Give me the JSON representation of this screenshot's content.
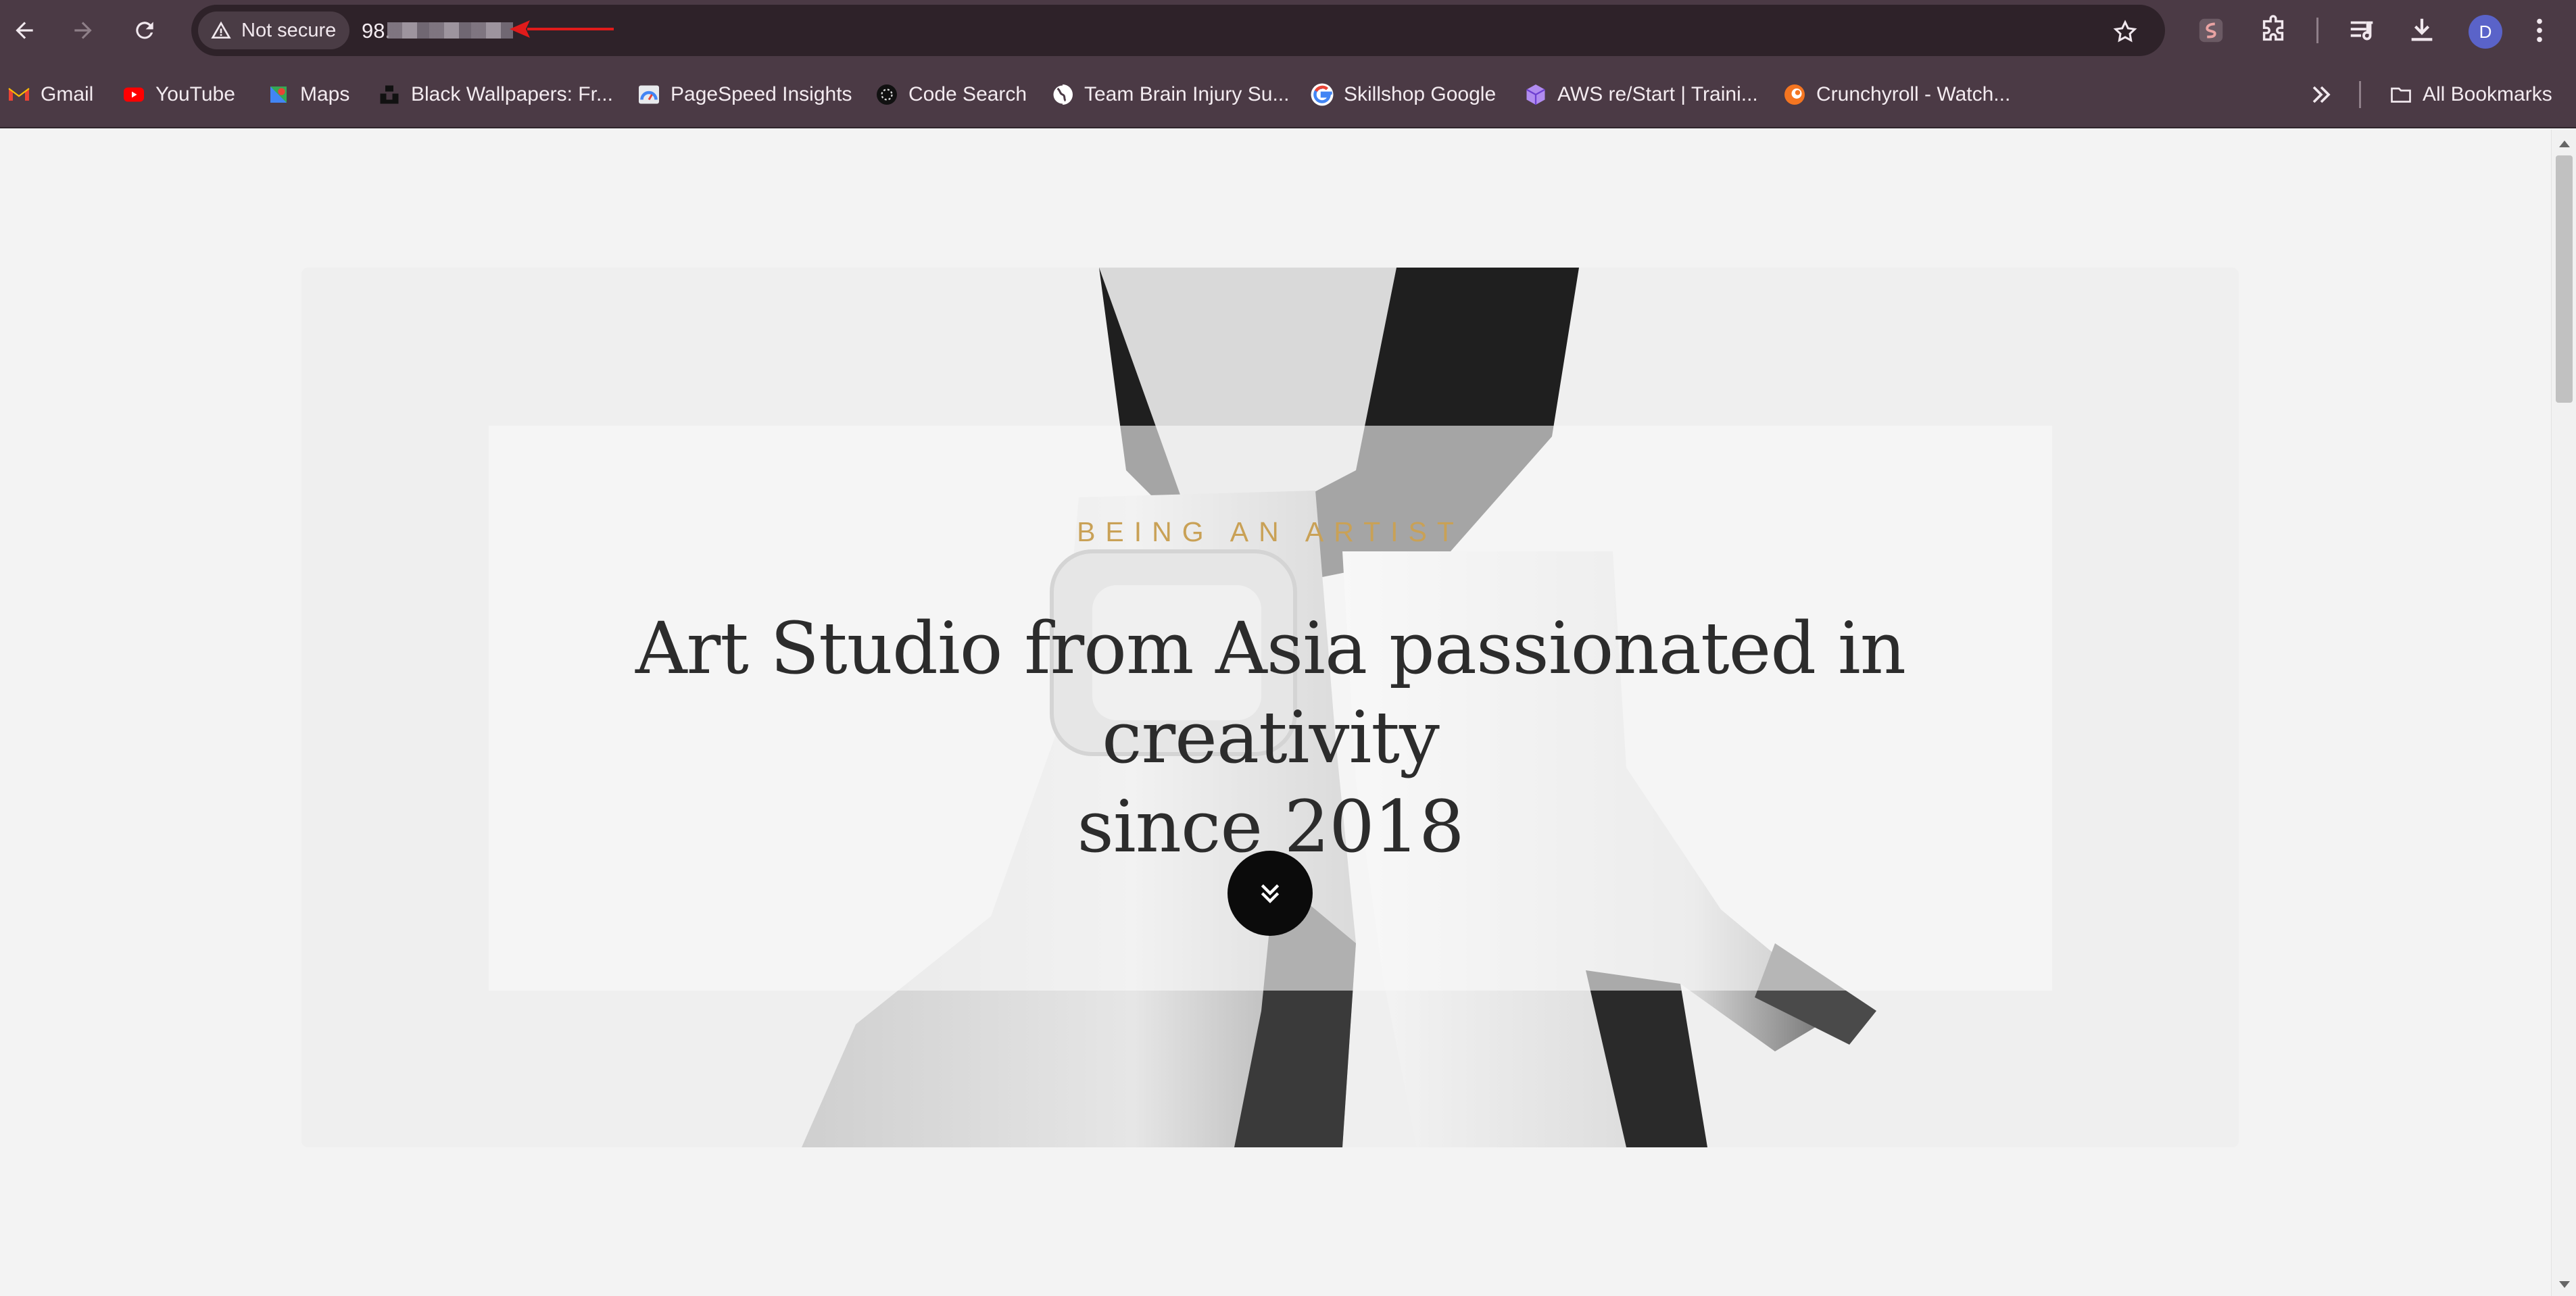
{
  "browser": {
    "security_label": "Not secure",
    "url_visible": "98.",
    "avatar_initial": "D"
  },
  "bookmarks": [
    {
      "label": "Gmail",
      "icon": "gmail-icon"
    },
    {
      "label": "YouTube",
      "icon": "youtube-icon"
    },
    {
      "label": "Maps",
      "icon": "maps-icon"
    },
    {
      "label": "Black Wallpapers: Fr...",
      "icon": "unsplash-icon"
    },
    {
      "label": "PageSpeed Insights",
      "icon": "pagespeed-icon"
    },
    {
      "label": "Code Search",
      "icon": "code-search-icon"
    },
    {
      "label": "Team Brain Injury Su...",
      "icon": "globe-icon"
    },
    {
      "label": "Skillshop Google",
      "icon": "google-icon"
    },
    {
      "label": "AWS re/Start | Traini...",
      "icon": "aws-cube-icon"
    },
    {
      "label": "Crunchyroll - Watch...",
      "icon": "crunchyroll-icon"
    }
  ],
  "all_bookmarks_label": "All Bookmarks",
  "hero": {
    "eyebrow": "BEING AN ARTIST",
    "headline_line1": "Art Studio from Asia passionated in creativity",
    "headline_line2": "since 2018"
  },
  "colors": {
    "chrome": "#4b3a45",
    "omnibox": "#2e2229",
    "accent_gold": "#c9a156",
    "annotation_red": "#e01b1b"
  }
}
